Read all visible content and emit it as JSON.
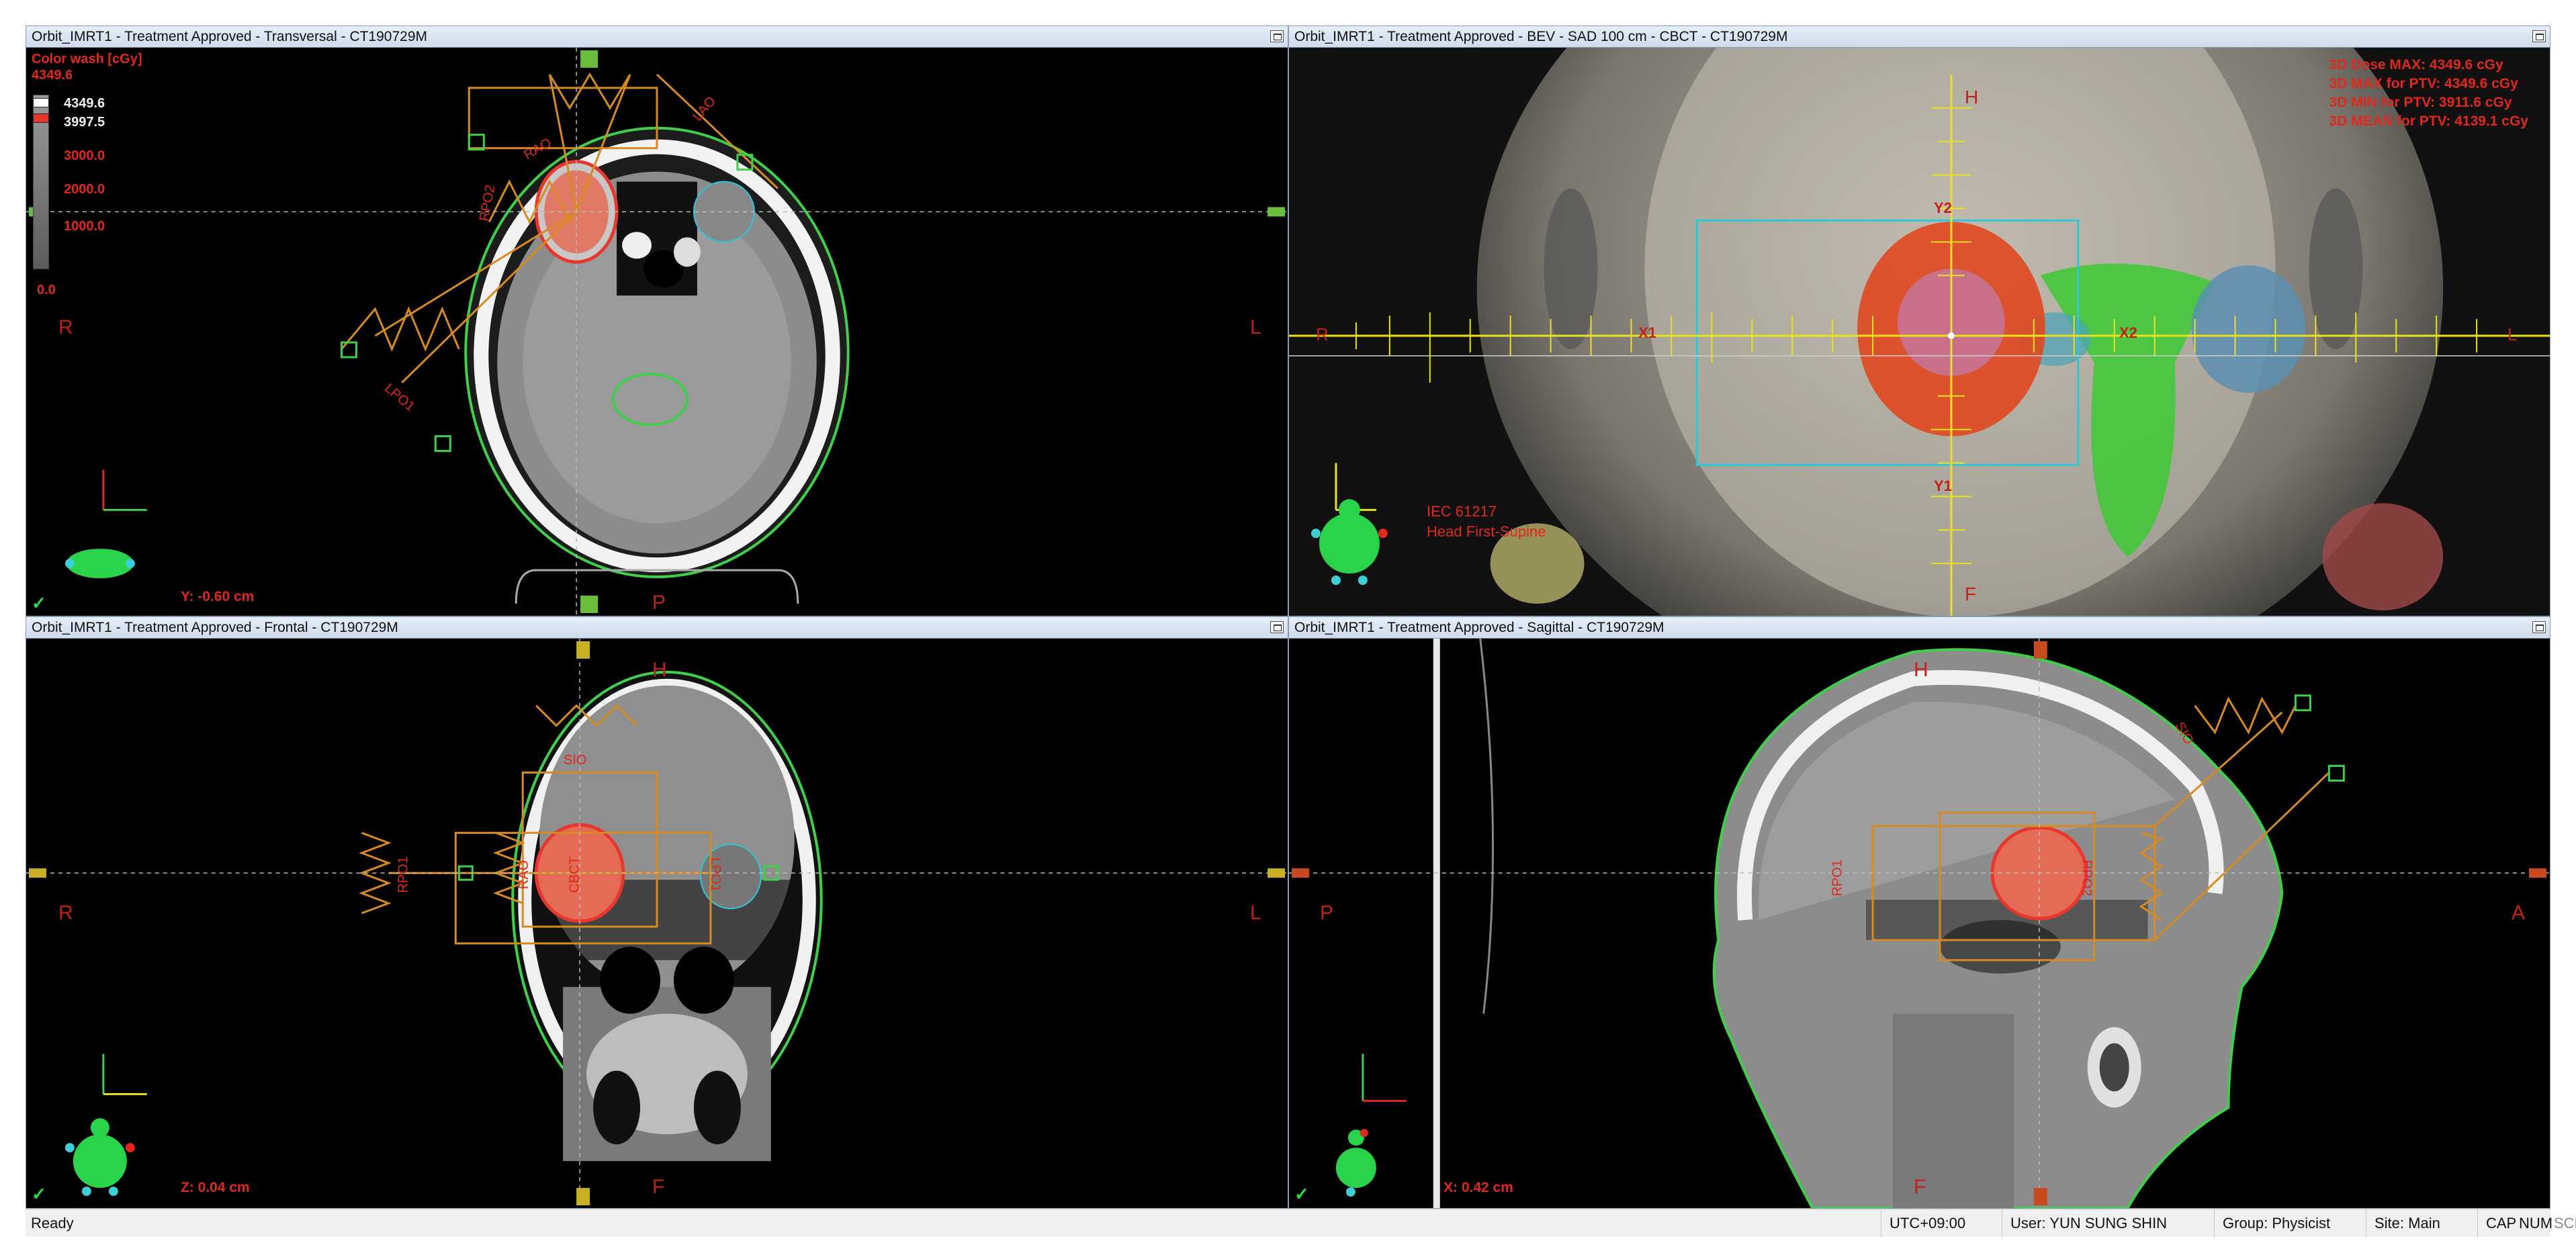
{
  "panes": {
    "transversal": {
      "title": "Orbit_IMRT1  -  Treatment Approved - Transversal - CT190729M",
      "orient_left": "R",
      "orient_right": "L",
      "orient_bottom": "P",
      "beam_labels": [
        "RPO2",
        "LPO1",
        "LAO",
        "RAO"
      ],
      "coord": "Y: -0.60 cm",
      "colorwash": {
        "title": "Color wash [cGy]",
        "max": "4349.6",
        "levels": [
          "4349.6",
          "3997.5",
          "3000.0",
          "2000.0",
          "1000.0",
          "0.0"
        ],
        "top_marker_color": "#ffffff",
        "bottom_marker_color": "#e8372c"
      }
    },
    "bev": {
      "title": "Orbit_IMRT1  -  Treatment Approved - BEV - SAD 100 cm - CBCT - CT190729M",
      "axis_labels": {
        "top": "H",
        "bottom": "F",
        "left": "R",
        "right": "L",
        "x1": "X1",
        "x2": "X2",
        "y1": "Y1",
        "y2": "Y2"
      },
      "iec_line1": "IEC 61217",
      "iec_line2": "Head First-Supine",
      "dose_stats": [
        "3D Dose MAX: 4349.6 cGy",
        "3D MAX for PTV: 4349.6 cGy",
        "3D MIN for PTV: 3911.6 cGy",
        "3D MEAN for PTV: 4139.1 cGy"
      ]
    },
    "frontal": {
      "title": "Orbit_IMRT1  -  Treatment Approved - Frontal - CT190729M",
      "orient_top": "H",
      "orient_bottom": "F",
      "orient_left": "R",
      "orient_right": "L",
      "beam_labels": [
        "SIO",
        "RPO1",
        "RAO",
        "CBCT",
        "LPO1"
      ],
      "coord": "Z: 0.04 cm"
    },
    "sagittal": {
      "title": "Orbit_IMRT1  -  Treatment Approved - Sagittal - CT190729M",
      "orient_top": "H",
      "orient_bottom": "F",
      "orient_left": "P",
      "orient_right": "A",
      "beam_labels": [
        "SIO",
        "RPO1",
        "RPO2"
      ],
      "coord": "X: 0.42 cm"
    }
  },
  "check_mark": "✓",
  "statusbar": {
    "ready": "Ready",
    "timezone": "UTC+09:00",
    "user": "User: YUN SUNG SHIN",
    "group": "Group: Physicist",
    "site": "Site: Main",
    "cap": "CAP",
    "num": "NUM",
    "scrl": "SCRL"
  },
  "colors": {
    "contour_body": "#3fcf4a",
    "ptv": "#e8372c",
    "beam": "#d88a22",
    "crosshair_bev": "#e8e21c",
    "field_rect": "#2fc6d8"
  }
}
